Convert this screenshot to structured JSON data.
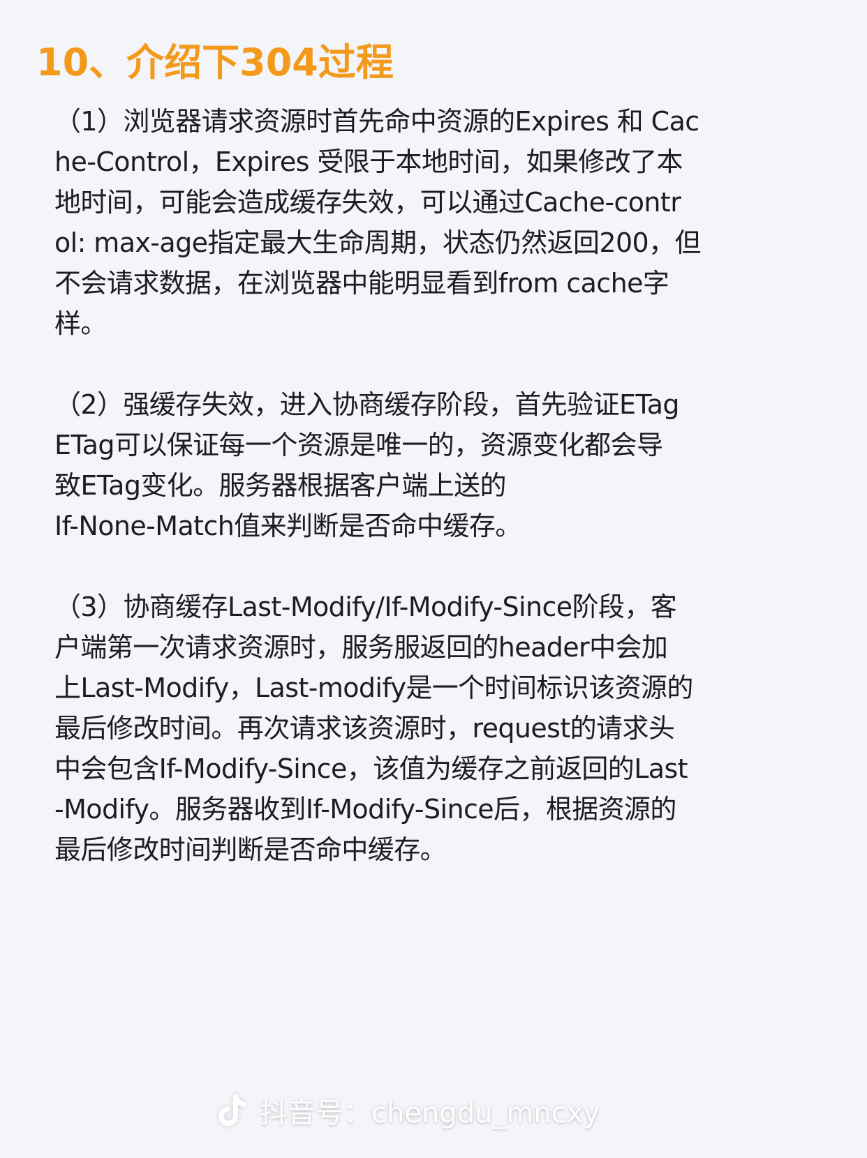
{
  "title": "10、介绍下304过程",
  "paragraphs": [
    {
      "lines": [
        "（1）浏览器请求资源时首先命中资源的Expires 和 Cac",
        "he-Control，Expires 受限于本地时间，如果修改了本",
        "地时间，可能会造成缓存失效，可以通过Cache-contr",
        "ol: max-age指定最大生命周期，状态仍然返回200，但",
        "不会请求数据，在浏览器中能明显看到from cache字",
        "样。"
      ]
    },
    {
      "lines": [
        "（2）强缓存失效，进入协商缓存阶段，首先验证ETag",
        "ETag可以保证每一个资源是唯一的，资源变化都会导",
        "致ETag变化。服务器根据客户端上送的",
        "If-None-Match值来判断是否命中缓存。"
      ]
    },
    {
      "lines": [
        "（3）协商缓存Last-Modify/If-Modify-Since阶段，客",
        "户端第一次请求资源时，服务服返回的header中会加",
        "上Last-Modify，Last-modify是一个时间标识该资源的",
        "最后修改时间。再次请求该资源时，request的请求头",
        "中会包含If-Modify-Since，该值为缓存之前返回的Last",
        "-Modify。服务器收到If-Modify-Since后，根据资源的",
        "最后修改时间判断是否命中缓存。"
      ]
    }
  ],
  "watermark": {
    "text": "抖音号：chengdu_mncxy",
    "icon": "tiktok-icon"
  },
  "colors": {
    "title": "#f39a1c",
    "background": "#f4f5f9",
    "text": "#1d1d1f"
  }
}
